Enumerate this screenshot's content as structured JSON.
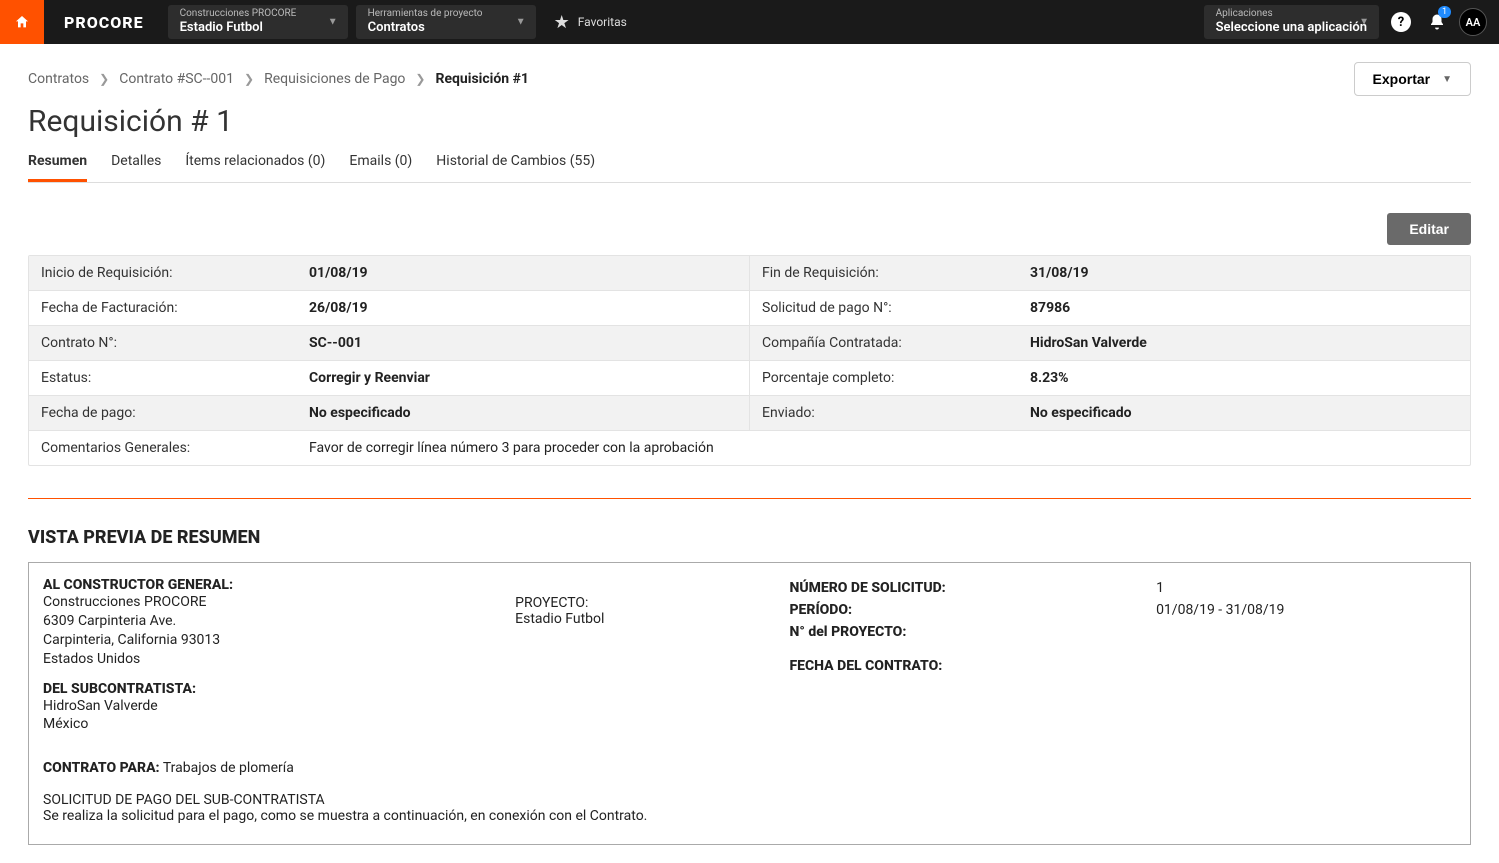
{
  "header": {
    "logo": "PROCORE",
    "company": {
      "label": "Construcciones PROCORE",
      "value": "Estadio Futbol"
    },
    "tools": {
      "label": "Herramientas de proyecto",
      "value": "Contratos"
    },
    "favorites": "Favoritas",
    "apps": {
      "label": "Aplicaciones",
      "value": "Seleccione una aplicación"
    },
    "notification_count": "1",
    "avatar": "AA"
  },
  "breadcrumbs": {
    "items": [
      "Contratos",
      "Contrato #SC--001",
      "Requisiciones de Pago"
    ],
    "current": "Requisición #1"
  },
  "export_label": "Exportar",
  "page_title": "Requisición # 1",
  "tabs": [
    "Resumen",
    "Detalles",
    "Ítems relacionados (0)",
    "Emails (0)",
    "Historial de Cambios (55)"
  ],
  "edit_label": "Editar",
  "summary": {
    "rows": [
      {
        "l1": "Inicio de Requisición:",
        "v1": "01/08/19",
        "l2": "Fin de Requisición:",
        "v2": "31/08/19"
      },
      {
        "l1": "Fecha de Facturación:",
        "v1": "26/08/19",
        "l2": "Solicitud de pago N°:",
        "v2": "87986"
      },
      {
        "l1": "Contrato N°:",
        "v1": "SC--001",
        "l2": "Compañía Contratada:",
        "v2": "HidroSan Valverde"
      },
      {
        "l1": "Estatus:",
        "v1": "Corregir y Reenviar",
        "l2": "Porcentaje completo:",
        "v2": "8.23%"
      },
      {
        "l1": "Fecha de pago:",
        "v1": "No especificado",
        "l2": "Enviado:",
        "v2": "No especificado"
      }
    ],
    "comments_label": "Comentarios Generales:",
    "comments_value": "Favor de corregir línea número 3 para proceder con la aprobación"
  },
  "preview": {
    "title": "VISTA PREVIA DE RESUMEN",
    "gc_label": "AL CONSTRUCTOR GENERAL:",
    "gc_lines": [
      "Construcciones PROCORE",
      "6309 Carpinteria Ave.",
      "Carpinteria, California 93013",
      "Estados Unidos"
    ],
    "sub_label": "DEL SUBCONTRATISTA:",
    "sub_lines": [
      "HidroSan Valverde",
      "México"
    ],
    "project_label": "PROYECTO:",
    "project_value": "Estadio Futbol",
    "right_rows": [
      {
        "k": "NÚMERO DE SOLICITUD:",
        "v": "1"
      },
      {
        "k": "PERÍODO:",
        "v": "01/08/19 - 31/08/19"
      },
      {
        "k": "N° del PROYECTO:",
        "v": ""
      },
      {
        "k": "FECHA DEL CONTRATO:",
        "v": ""
      }
    ],
    "contract_for_label": "CONTRATO PARA:",
    "contract_for_value": "Trabajos de plomería",
    "foot1": "SOLICITUD DE PAGO DEL SUB-CONTRATISTA",
    "foot2": "Se realiza la solicitud para el pago, como se muestra a continuación, en conexión con el Contrato."
  }
}
